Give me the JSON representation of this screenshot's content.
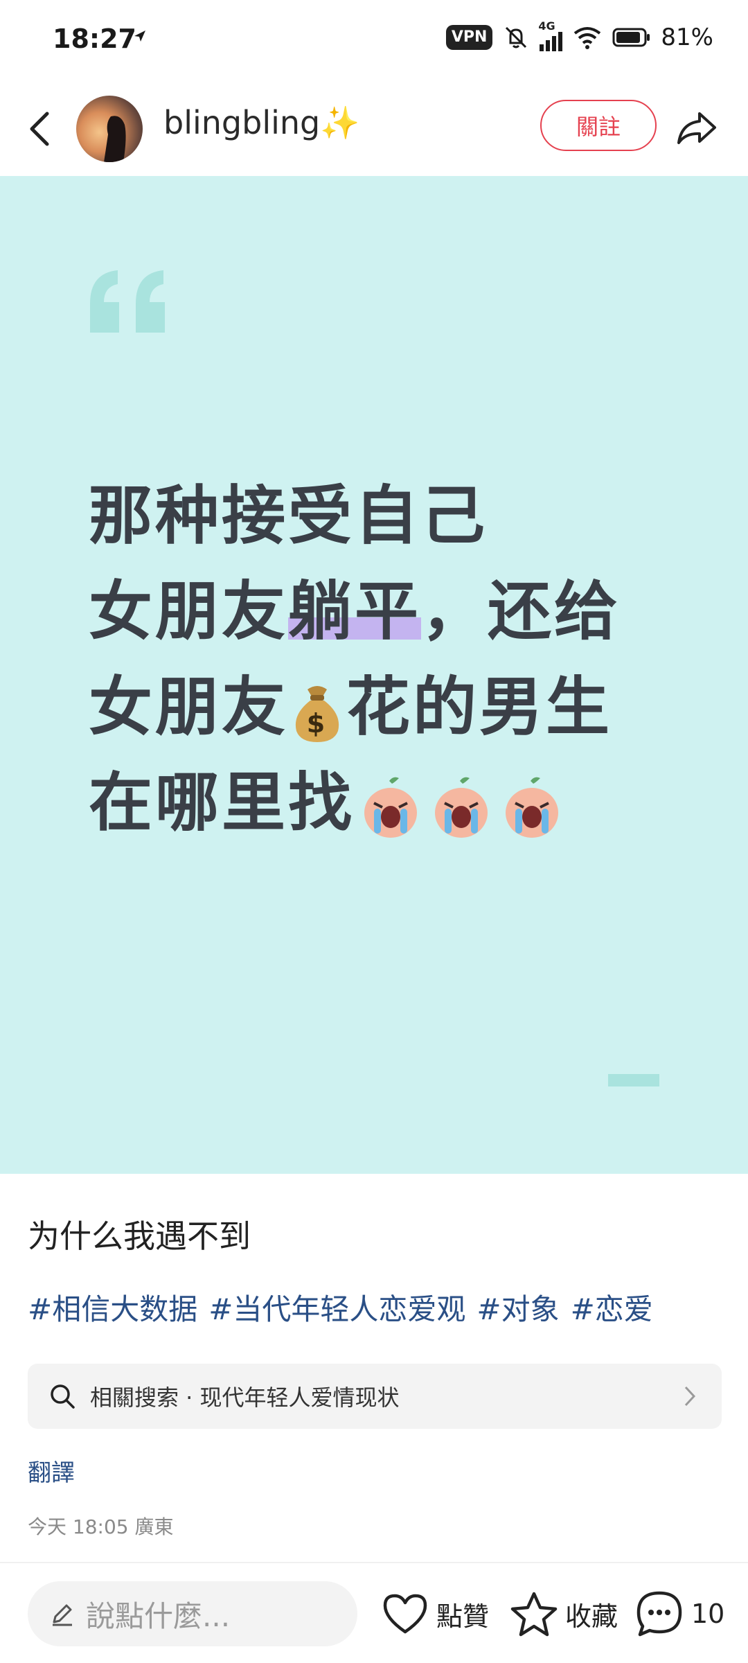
{
  "status_bar": {
    "time": "18:27",
    "vpn_label": "VPN",
    "network_label": "4G",
    "battery": "81%"
  },
  "header": {
    "username": "blingbling✨",
    "follow_label": "關註"
  },
  "post_card": {
    "lines": [
      "那种接受自己",
      "女朋友",
      "躺平",
      "，还给",
      "女朋友",
      "花的男生",
      "在哪里找"
    ]
  },
  "post": {
    "title": "为什么我遇不到",
    "tags": [
      "#相信大数据",
      "#当代年轻人恋爱观",
      "#对象",
      "#恋爱"
    ],
    "related_search": "相關搜索 · 现代年轻人爱情现状",
    "translate_label": "翻譯",
    "meta": "今天 18:05 廣東"
  },
  "bottom_bar": {
    "comment_placeholder": "說點什麼...",
    "like_label": "點贊",
    "favorite_label": "收藏",
    "comment_count": "10"
  },
  "colors": {
    "card_background": "#cff2f1",
    "follow_accent": "#e5414f",
    "tag_color": "#2a4f86",
    "highlight": "#c4b4f0"
  }
}
